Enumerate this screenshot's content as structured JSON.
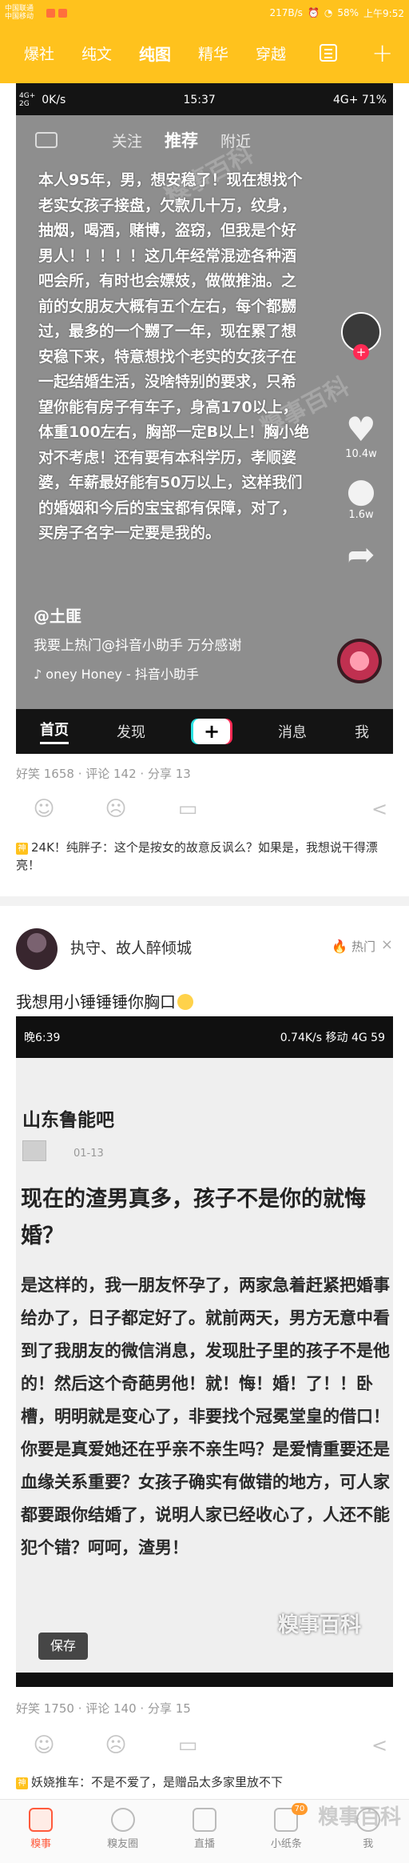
{
  "status_bar": {
    "carrier_1": "中国联通",
    "carrier_2": "中国移动",
    "speed": "217B/s",
    "battery": "58%",
    "time": "上午9:52"
  },
  "top_tabs": {
    "items": [
      "爆社",
      "纯文",
      "纯图",
      "精华",
      "穿越"
    ],
    "active": "纯图",
    "plus": "+"
  },
  "post1": {
    "shot": {
      "status": {
        "net_top": "4G+",
        "net_bottom": "2G",
        "speed": "0K/s",
        "time": "15:37",
        "right": "4G+ 71%"
      },
      "feed_tabs": [
        "关注",
        "推荐",
        "附近"
      ],
      "active_feed_tab": "推荐",
      "body": "本人95年，男，想安稳了！现在想找个老实女孩子接盘，欠款几十万，纹身，抽烟，喝酒，赌博，盗窃，但我是个好男人！！！！！这几年经常混迹各种酒吧会所，有时也会嫖妓，做做推油。之前的女朋友大概有五个左右，每个都嬲过，最多的一个嬲了一年，现在累了想安稳下来，特意想找个老实的女孩子在一起结婚生活，没啥特别的要求，只希望你能有房子有车子，身高170以上，体重100左右，胸部一定B以上！胸小绝对不考虑！还有要有本科学历，孝顺婆婆，年薪最好能有50万以上，这样我们的婚姻和今后的宝宝都有保障，对了，买房子名字一定要是我的。",
      "author": "@土匪",
      "desc": "我要上热门@抖音小助手 万分感谢",
      "music": "♪ oney Honey - 抖音小助手",
      "likes": "10.4w",
      "comments": "1.6w",
      "nav": [
        "首页",
        "发现",
        "+",
        "消息",
        "我"
      ],
      "active_nav": "首页",
      "watermark": "糗事百科"
    },
    "stats": "好笑 1658 · 评论 142 · 分享 13",
    "god_comment": "24K！纯胖子：这个是按女的故意反讽么？如果是，我想说干得漂亮！"
  },
  "post2": {
    "username": "执守、故人醉倾城",
    "hot_label": "热门",
    "close": "×",
    "title": "我想用小锤锤锤你胸口",
    "shot": {
      "status_left": "晚6:39",
      "status_right": "0.74K/s  移动 4G  59",
      "forum": "山东鲁能吧",
      "date": "01-13",
      "headline": "现在的渣男真多，孩子不是你的就悔婚？",
      "content": "是这样的，我一朋友怀孕了，两家急着赶紧把婚事给办了，日子都定好了。就前两天，男方无意中看到了我朋友的微信消息，发现肚子里的孩子不是他的！然后这个奇葩男他！就！悔！婚！了！！卧槽，明明就是变心了，非要找个冠冕堂皇的借口！你要是真爱她还在乎亲不亲生吗？是爱情重要还是血缘关系重要？女孩子确实有做错的地方，可人家都要跟你结婚了，说明人家已经收心了，人还不能犯个错？呵呵，渣男！",
      "save": "保存",
      "watermark": "糗事百科"
    },
    "stats": "好笑 1750 · 评论 140 · 分享 15",
    "god_comment": "妖娆推车：不是不爱了，是赠品太多家里放不下"
  },
  "bottom_nav": {
    "items": [
      {
        "label": "糗事",
        "active": true
      },
      {
        "label": "糗友圈",
        "active": false
      },
      {
        "label": "直播",
        "active": false
      },
      {
        "label": "小纸条",
        "active": false,
        "badge": "70"
      },
      {
        "label": "我",
        "active": false
      }
    ]
  },
  "icons": {
    "like": "smile-icon",
    "dislike": "frown-icon",
    "comment": "comment-icon",
    "share": "share-icon"
  },
  "colors": {
    "brand": "#ffc21d",
    "active_nav": "#ff5a3c",
    "hot": "#ff5a2a"
  }
}
